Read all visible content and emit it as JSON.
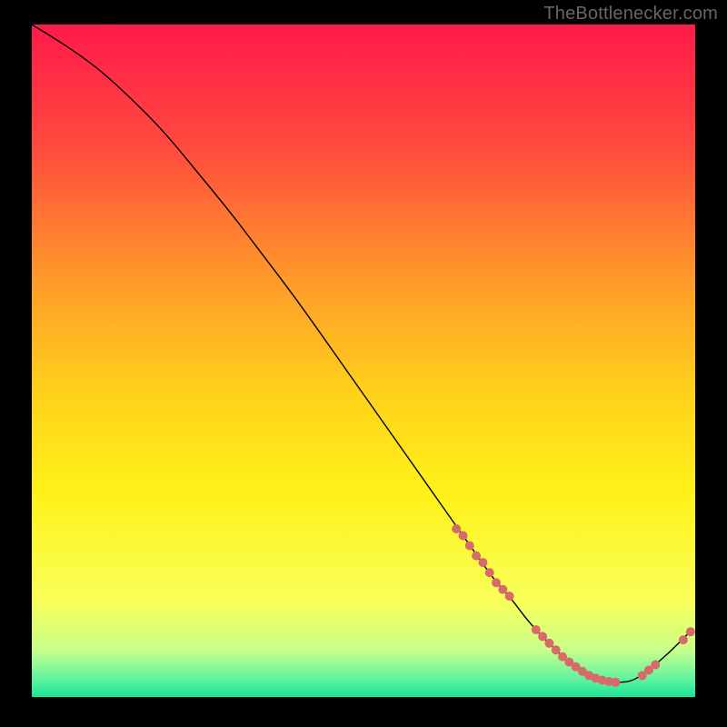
{
  "watermark": "TheBottlenecker.com",
  "chart_data": {
    "type": "line",
    "title": "",
    "xlabel": "",
    "ylabel": "",
    "xlim": [
      0,
      100
    ],
    "ylim": [
      0,
      100
    ],
    "background_gradient": {
      "stops": [
        {
          "offset": 0.0,
          "color": "#ff1a4a"
        },
        {
          "offset": 0.18,
          "color": "#ff4a3e"
        },
        {
          "offset": 0.38,
          "color": "#ff9a2a"
        },
        {
          "offset": 0.55,
          "color": "#ffd21a"
        },
        {
          "offset": 0.7,
          "color": "#fff21a"
        },
        {
          "offset": 0.86,
          "color": "#f7ff5a"
        },
        {
          "offset": 0.93,
          "color": "#c8ff8a"
        },
        {
          "offset": 0.975,
          "color": "#5ef2a0"
        },
        {
          "offset": 1.0,
          "color": "#1ae296"
        }
      ]
    },
    "series": [
      {
        "name": "curve",
        "type": "line",
        "color": "#000000",
        "x": [
          0,
          5,
          10,
          15,
          20,
          25,
          30,
          35,
          40,
          45,
          50,
          55,
          60,
          65,
          70,
          72,
          75,
          78,
          80,
          83,
          86,
          90,
          93,
          96,
          99
        ],
        "y": [
          100,
          97,
          93.5,
          89,
          84,
          78,
          72,
          65.5,
          59,
          52,
          45,
          38,
          31,
          24,
          17,
          15,
          11,
          8,
          6,
          4,
          2.5,
          2,
          4,
          6.5,
          9.5
        ]
      },
      {
        "name": "highlight-points",
        "type": "scatter",
        "color": "#d86a6a",
        "size": 5,
        "x": [
          64,
          65,
          66,
          67,
          68,
          69,
          70,
          71,
          72,
          76,
          77,
          78,
          79,
          80,
          81,
          82,
          83,
          84,
          85,
          86,
          87,
          88,
          92,
          93,
          94,
          98.2,
          99.3
        ],
        "y": [
          25,
          24,
          22.5,
          21,
          20,
          18.5,
          17,
          16,
          15,
          10,
          9,
          8,
          7,
          6,
          5.2,
          4.5,
          3.8,
          3.2,
          2.8,
          2.5,
          2.3,
          2.2,
          3.2,
          4,
          4.8,
          8.5,
          9.7
        ]
      }
    ]
  }
}
